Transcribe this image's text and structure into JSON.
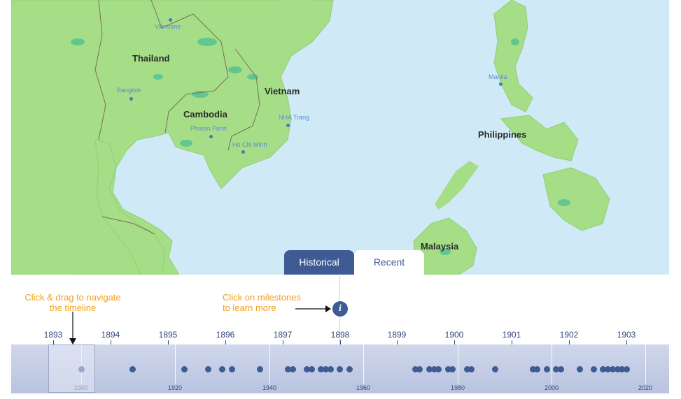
{
  "map": {
    "countries": [
      "Thailand",
      "Vietnam",
      "Cambodia",
      "Philippines",
      "Malaysia"
    ],
    "cities": [
      "Vientiane",
      "Bangkok",
      "Phnom Penh",
      "Ho Chi Minh",
      "NHA Trang",
      "Manila"
    ],
    "colors": {
      "water": "#cfeaf6",
      "land": "#a6de88",
      "forest": "#62c68f",
      "border": "#7b6e5a"
    }
  },
  "tabs": {
    "historical": "Historical",
    "recent": "Recent",
    "active": "Historical"
  },
  "hints": {
    "drag_line1": "Click & drag to navigate",
    "drag_line2": "the timeline",
    "milestone_line1": "Click on milestones",
    "milestone_line2": "to learn more"
  },
  "info_icon": "i",
  "timeline": {
    "years": [
      "1893",
      "1894",
      "1895",
      "1896",
      "1897",
      "1898",
      "1899",
      "1900",
      "1901",
      "1902",
      "1903"
    ],
    "decades": [
      "1900",
      "1920",
      "1940",
      "1960",
      "1980",
      "2000",
      "2020"
    ],
    "milestone_years": [
      1900,
      1911,
      1922,
      1927,
      1930,
      1932,
      1938,
      1944,
      1945,
      1948,
      1949,
      1951,
      1952,
      1953,
      1955,
      1957,
      1971,
      1972,
      1974,
      1975,
      1976,
      1978,
      1979,
      1982,
      1983,
      1988,
      1996,
      1997,
      1999,
      2001,
      2002,
      2006,
      2009,
      2011,
      2012,
      2013,
      2014,
      2015,
      2016
    ],
    "accent": "#3e5b94"
  }
}
